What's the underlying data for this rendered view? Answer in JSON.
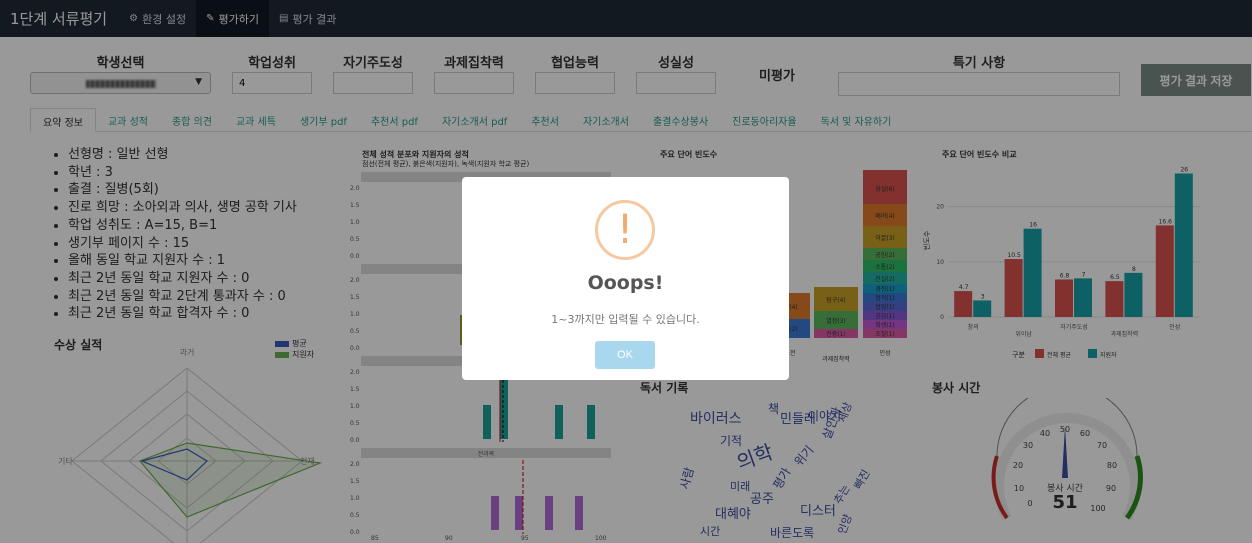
{
  "navbar": {
    "brand": "1단계 서류평기",
    "items": [
      {
        "label": "환경 설정",
        "icon": "gears-icon"
      },
      {
        "label": "평가하기",
        "icon": "edit-icon"
      },
      {
        "label": "평가 결과",
        "icon": "document-icon"
      }
    ]
  },
  "form": {
    "student_select_label": "학생선택",
    "academic_label": "학업성취",
    "academic_value": "4",
    "selfdirect_label": "자기주도성",
    "task_label": "과제집착력",
    "collab_label": "협업능력",
    "sincerity_label": "성실성",
    "unrated_label": "미평가",
    "notes_label": "특기 사항",
    "save_label": "평가 결과 저장"
  },
  "tabs": [
    "요약 정보",
    "교과 성적",
    "종합 의견",
    "교과 세특",
    "생기부 pdf",
    "추천서 pdf",
    "자기소개서 pdf",
    "추천서",
    "자기소개서",
    "출결수상봉사",
    "진로동아리자율",
    "독서 및 자유하기"
  ],
  "summary": [
    "선형명 : 일반 선형",
    "학년 : 3",
    "출결 : 질병(5회)",
    "진로 희망 : 소아외과 의사, 생명 공학 기사",
    "학업 성취도 : A=15, B=1",
    "생기부 페이지 수 : 15",
    "올해 동일 학교 지원자 수 : 1",
    "최근 2년 동일 학교 지원자 수 : 0",
    "최근 2년 동일 학교 2단계 통과자 수 : 0",
    "최근 2년 동일 학교 합격자 수 : 0"
  ],
  "sections": {
    "awards_title": "수상 실적",
    "radar_top": "과거",
    "radar_left": "기타",
    "radar_right": "현재",
    "legend_avg": "평균",
    "legend_applicant": "지원자",
    "dist_title": "전체 성적 분포와 지원자의 성적",
    "dist_subtitle": "점선(전체 평균), 붉은색(지원자), 녹색(지원자 학교 평균)",
    "dist_panel_label": "전과목",
    "freq_title": "주요 단어 빈도수",
    "compare_title": "주요 단어 빈도수 비교",
    "compare_ylabel": "빈도수",
    "compare_legend_title": "구분",
    "compare_legend_all": "전체 평균",
    "compare_legend_app": "지원자",
    "reading_title": "독서 기록",
    "volunteer_title": "봉사 시간",
    "gauge_label": "봉사 시간",
    "gauge_value": "51"
  },
  "freq_bars": {
    "labels": [
      "성실(6)",
      "배려(4)",
      "이끌(3)",
      "공헌(2)",
      "소통(2)",
      "진실(2)",
      "경청(1)",
      "정직(1)",
      "협업(1)",
      "공감(1)",
      "희생(1)",
      "조절(1)",
      "탐구(4)",
      "열정(3)",
      "진중(1)",
      "도전(4)",
      "창의(2)"
    ],
    "x_labels": [
      "도전",
      "과제집착력",
      "인성"
    ]
  },
  "chart_data": {
    "type": "bar",
    "title": "주요 단어 빈도수 비교",
    "ylabel": "빈도수",
    "categories": [
      "창의",
      "위이남",
      "자기주도성",
      "과제집착력",
      "인성"
    ],
    "series": [
      {
        "name": "전체 평균",
        "values": [
          4.7,
          10.5,
          6.8,
          6.5,
          16.6
        ]
      },
      {
        "name": "지원자",
        "values": [
          3,
          16,
          7,
          8,
          26
        ]
      }
    ],
    "ylim": [
      0,
      27
    ],
    "yticks": [
      0,
      10,
      20
    ],
    "colors": [
      "#d9534f",
      "#17a2a8"
    ]
  },
  "wordcloud": [
    "바이러스",
    "책",
    "민들레",
    "살인자",
    "세상",
    "의학",
    "공주",
    "기적",
    "대혜야",
    "시간",
    "위기",
    "바른도록",
    "평가",
    "사람",
    "이야기",
    "디스터",
    "추는",
    "인양",
    "미래",
    "빠진"
  ],
  "gauge": {
    "ticks": [
      "0",
      "10",
      "20",
      "30",
      "40",
      "50",
      "60",
      "70",
      "80",
      "90",
      "100"
    ],
    "value": 51
  },
  "modal": {
    "title": "Ooops!",
    "message": "1~3까지만 입력될 수 있습니다.",
    "ok_label": "OK"
  }
}
